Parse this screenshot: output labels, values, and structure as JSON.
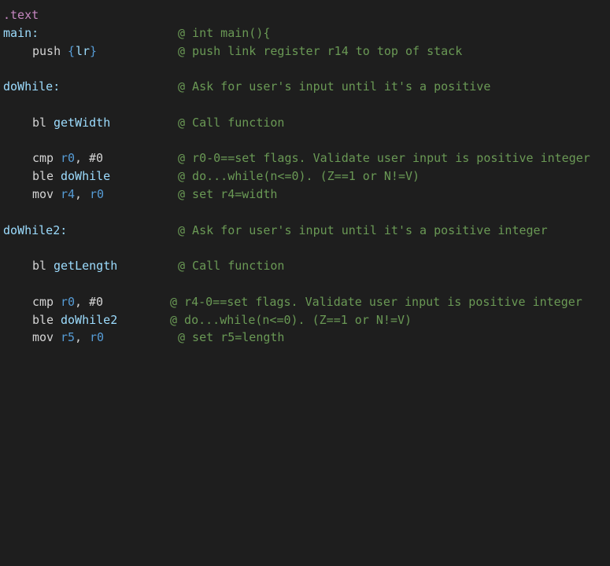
{
  "colors": {
    "background": "#1e1e1e",
    "directive": "#c586c0",
    "label": "#9cdcfe",
    "instruction": "#d4d4d4",
    "register": "#569cd6",
    "immediate": "#d4d4d4",
    "brace": "#569cd6",
    "function_name": "#9cdcfe",
    "comment": "#6a9955"
  },
  "lines": [
    {
      "directive": ".text"
    },
    {
      "label": "main:",
      "comment": "@ int main(){"
    },
    {
      "mnemonic": "push",
      "brace_open": "{",
      "reg1": "lr",
      "brace_close": "}",
      "comment": "@ push link register r14 to top of stack"
    },
    {
      "label": "doWhile:",
      "comment": "@ Ask for user's input until it's a positive"
    },
    {
      "mnemonic": "bl",
      "target": "getWidth",
      "comment": "@ Call function"
    },
    {
      "mnemonic": "cmp",
      "reg1": "r0",
      "sep": ",",
      "imm": "#0",
      "comment": "@ r0-0==set flags. Validate user input is positive integer"
    },
    {
      "mnemonic": "ble",
      "target": "doWhile",
      "comment": "@ do...while(n<=0). (Z==1 or N!=V)"
    },
    {
      "mnemonic": "mov",
      "reg1": "r4",
      "sep": ",",
      "reg2": "r0",
      "comment": "@ set r4=width"
    },
    {
      "label": "doWhile2:",
      "comment": "@ Ask for user's input until it's a positive integer"
    },
    {
      "mnemonic": "bl",
      "target": "getLength",
      "comment": "@ Call function"
    },
    {
      "mnemonic": "cmp",
      "reg1": "r0",
      "sep": ",",
      "imm": "#0",
      "comment": "@ r4-0==set flags. Validate user input is positive integer"
    },
    {
      "mnemonic": "ble",
      "target": "doWhile2",
      "comment": "@ do...while(n<=0). (Z==1 or N!=V)"
    },
    {
      "mnemonic": "mov",
      "reg1": "r5",
      "sep": ",",
      "reg2": "r0",
      "comment": "@ set r5=length"
    }
  ]
}
